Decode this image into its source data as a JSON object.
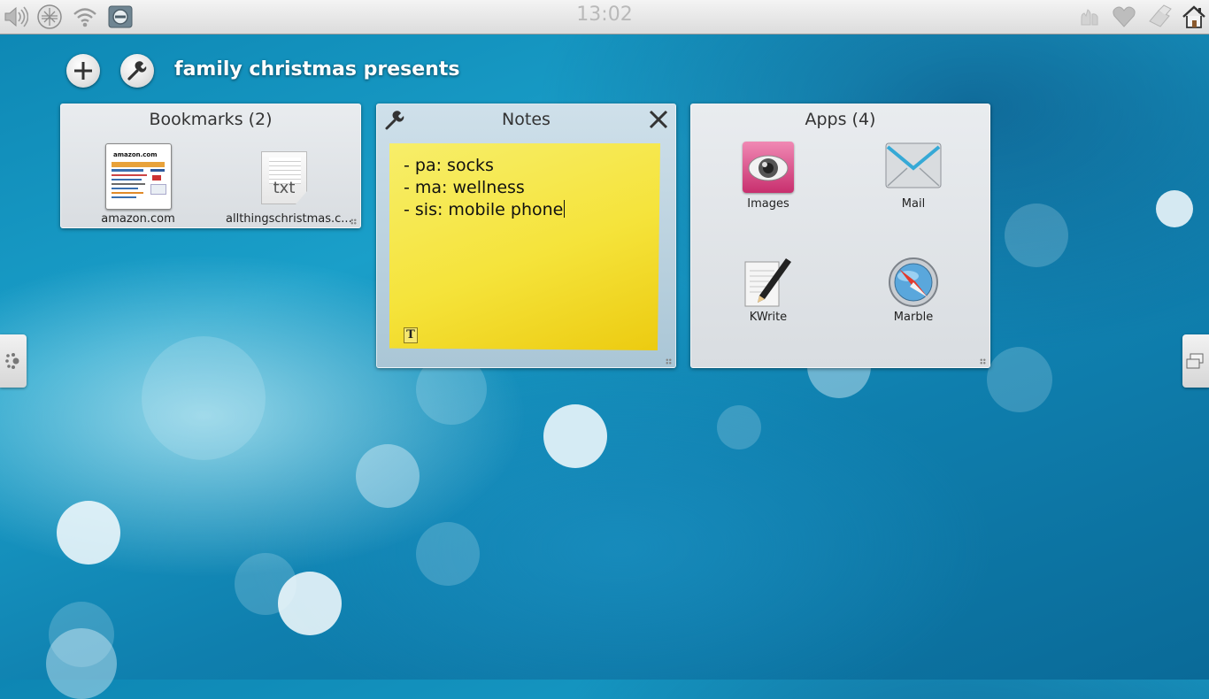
{
  "topbar": {
    "clock": "13:02",
    "left_icons": [
      "volume-icon",
      "network-icon",
      "wifi-icon",
      "power-icon"
    ],
    "right_icons": [
      "notifications-icon",
      "favorite-heart-icon",
      "device-icon",
      "home-icon"
    ]
  },
  "activity": {
    "title": "family christmas presents",
    "add_icon": "plus-icon",
    "configure_icon": "wrench-icon"
  },
  "bookmarks": {
    "title": "Bookmarks (2)",
    "items": [
      {
        "label": "amazon.com",
        "icon": "webpage-thumbnail-icon",
        "thumb_text": "amazon.com"
      },
      {
        "label": "allthingschristmas.c...",
        "icon": "text-file-icon",
        "thumb_text": "txt"
      }
    ]
  },
  "notes": {
    "title": "Notes",
    "lines": [
      "- pa: socks",
      "- ma: wellness",
      "- sis: mobile phone"
    ],
    "format_glyph": "T"
  },
  "apps": {
    "title": "Apps (4)",
    "items": [
      {
        "label": "Images",
        "icon": "images-icon"
      },
      {
        "label": "Mail",
        "icon": "mail-icon"
      },
      {
        "label": "KWrite",
        "icon": "kwrite-icon"
      },
      {
        "label": "Marble",
        "icon": "marble-icon"
      }
    ]
  },
  "colors": {
    "sticky_yellow": "#f5e33a",
    "background_blue": "#1a9fc9",
    "images_pink": "#d9447e"
  }
}
